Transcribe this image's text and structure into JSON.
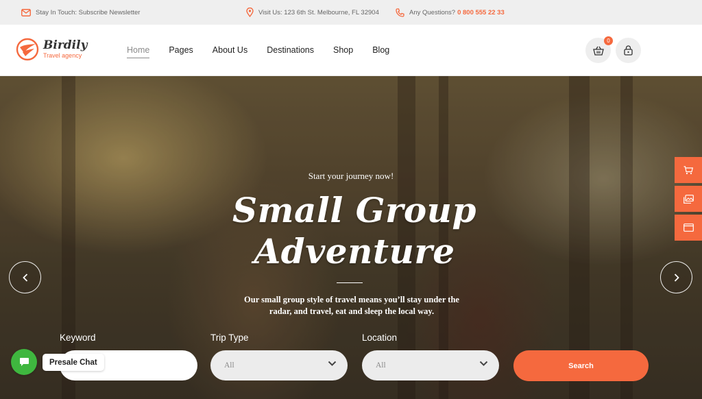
{
  "topbar": {
    "newsletter": "Stay In Touch: Subscribe Newsletter",
    "address": "Visit Us: 123 6th St. Melbourne, FL 32904",
    "questions_label": "Any Questions?",
    "phone": "0 800 555 22 33"
  },
  "brand": {
    "name": "Birdily",
    "tagline": "Travel agency",
    "accent_color": "#f5693e"
  },
  "nav": {
    "items": [
      {
        "label": "Home",
        "active": true
      },
      {
        "label": "Pages"
      },
      {
        "label": "About Us"
      },
      {
        "label": "Destinations"
      },
      {
        "label": "Shop"
      },
      {
        "label": "Blog"
      }
    ]
  },
  "header_actions": {
    "cart_icon": "basket-icon",
    "cart_count": "0",
    "account_icon": "lock-icon"
  },
  "hero": {
    "subtitle": "Start your journey now!",
    "title_line1": "Small Group",
    "title_line2": "Adventure",
    "description_line1": "Our small group style of travel means you’ll stay under the",
    "description_line2": "radar, and travel, eat and sleep the local way.",
    "prev_icon": "chevron-left-icon",
    "next_icon": "chevron-right-icon"
  },
  "side_tabs": [
    {
      "icon": "cart-icon"
    },
    {
      "icon": "images-icon"
    },
    {
      "icon": "browser-window-icon"
    }
  ],
  "search_form": {
    "keyword_label": "Keyword",
    "keyword_value": "",
    "trip_type_label": "Trip Type",
    "trip_type_value": "All",
    "location_label": "Location",
    "location_value": "All",
    "submit_label": "Search"
  },
  "chat": {
    "label": "Presale Chat",
    "icon": "chat-bubble-icon",
    "color": "#3fb73f"
  }
}
